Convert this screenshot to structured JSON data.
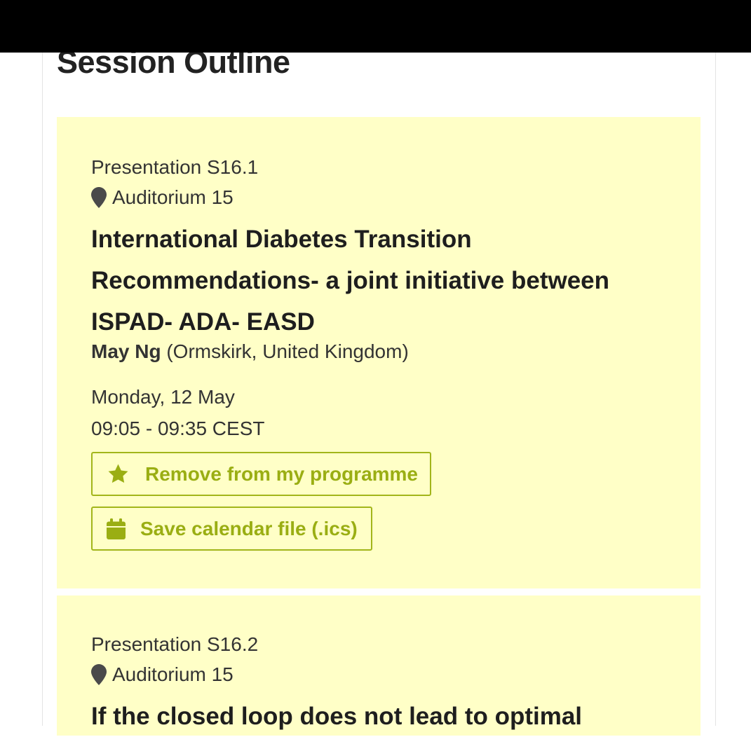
{
  "section": {
    "title": "Session Outline"
  },
  "presentations": [
    {
      "id_label": "Presentation S16.1",
      "location": "Auditorium 15",
      "title": "International Diabetes Transition Recommendations- a joint initiative between ISPAD- ADA- EASD",
      "speaker_name": "May Ng",
      "speaker_affiliation": "(Ormskirk, United Kingdom)",
      "date": "Monday, 12 May",
      "time": "09:05 - 09:35 CEST",
      "remove_button": "Remove from my programme",
      "calendar_button": "Save calendar file (.ics)"
    },
    {
      "id_label": "Presentation S16.2",
      "location": "Auditorium 15",
      "title": "If the closed loop does not lead to optimal"
    }
  ],
  "icons": {
    "location": "map-pin-icon",
    "remove": "star-icon",
    "calendar": "calendar-icon"
  },
  "colors": {
    "card_background": "#ffffc7",
    "accent": "#9aae13",
    "top_bar": "#000000"
  }
}
